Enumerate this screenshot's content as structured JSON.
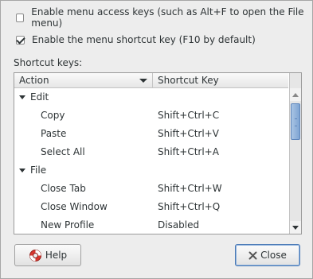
{
  "options": {
    "menu_access_keys_label": "Enable menu access keys (such as Alt+F to open the File menu)",
    "menu_access_keys_checked": false,
    "menu_shortcut_key_label": "Enable the menu shortcut key (F10 by default)",
    "menu_shortcut_key_checked": true
  },
  "shortcuts": {
    "section_label": "Shortcut keys:",
    "columns": {
      "action": "Action",
      "shortcut_key": "Shortcut Key"
    },
    "rows": [
      {
        "kind": "group",
        "label": "Edit"
      },
      {
        "kind": "item",
        "action": "Copy",
        "key": "Shift+Ctrl+C"
      },
      {
        "kind": "item",
        "action": "Paste",
        "key": "Shift+Ctrl+V"
      },
      {
        "kind": "item",
        "action": "Select All",
        "key": "Shift+Ctrl+A"
      },
      {
        "kind": "group",
        "label": "File"
      },
      {
        "kind": "item",
        "action": "Close Tab",
        "key": "Shift+Ctrl+W"
      },
      {
        "kind": "item",
        "action": "Close Window",
        "key": "Shift+Ctrl+Q"
      },
      {
        "kind": "item",
        "action": "New Profile",
        "key": "Disabled"
      }
    ]
  },
  "buttons": {
    "help_label": "Help",
    "close_label": "Close"
  },
  "icons": {
    "help": "lifebuoy-icon",
    "close": "close-x-icon"
  },
  "colors": {
    "scroll_thumb": "#7ea4d3",
    "default_button_border": "#4a79b5",
    "help_icon": "#d9362f"
  }
}
